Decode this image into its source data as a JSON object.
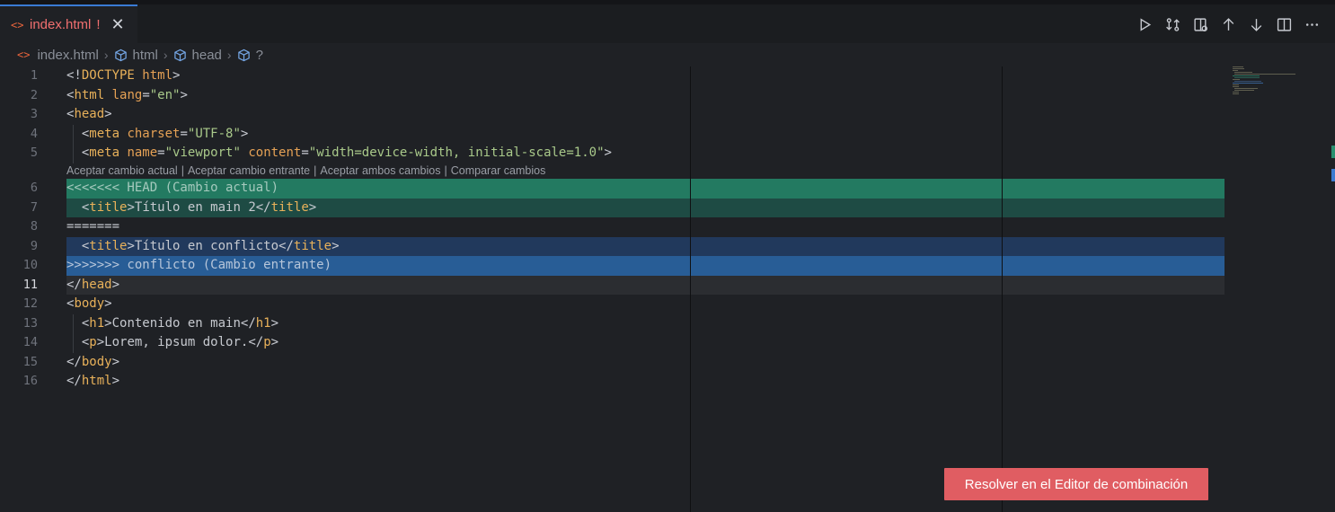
{
  "tab": {
    "file_icon": "<>",
    "label": "index.html",
    "modified_marker": "!",
    "close": "✕"
  },
  "toolbar": [
    {
      "name": "run-icon"
    },
    {
      "name": "compare-changes-icon"
    },
    {
      "name": "open-changes-icon"
    },
    {
      "name": "previous-conflict-icon"
    },
    {
      "name": "next-conflict-icon"
    },
    {
      "name": "split-editor-icon"
    },
    {
      "name": "more-actions-icon"
    }
  ],
  "breadcrumb": {
    "file_icon": "<>",
    "file": "index.html",
    "items": [
      "html",
      "head",
      "?"
    ]
  },
  "line_numbers": [
    "1",
    "2",
    "3",
    "4",
    "5",
    "6",
    "7",
    "8",
    "9",
    "10",
    "11",
    "12",
    "13",
    "14",
    "15",
    "16"
  ],
  "active_line": "11",
  "codelens": {
    "accept_current": "Aceptar cambio actual",
    "accept_incoming": "Aceptar cambio entrante",
    "accept_both": "Aceptar ambos cambios",
    "compare": "Comparar cambios",
    "separator": "|"
  },
  "code": {
    "l1": {
      "open": "<!",
      "tag": "DOCTYPE",
      "rest": " html",
      "close": ">"
    },
    "l2": {
      "open": "<",
      "tag": "html",
      "attr": " lang",
      "eq": "=",
      "val": "\"en\"",
      "close": ">"
    },
    "l3": {
      "open": "<",
      "tag": "head",
      "close": ">"
    },
    "l4": {
      "indent": "  ",
      "open": "<",
      "tag": "meta",
      "attr": " charset",
      "eq": "=",
      "val": "\"UTF-8\"",
      "close": ">"
    },
    "l5": {
      "indent": "  ",
      "open": "<",
      "tag": "meta",
      "attr1": " name",
      "eq1": "=",
      "val1": "\"viewport\"",
      "attr2": " content",
      "eq2": "=",
      "val2": "\"width=device-width, initial-scale=1.0\"",
      "close": ">"
    },
    "l6": {
      "text": "<<<<<<< HEAD (Cambio actual)"
    },
    "l7": {
      "indent": "  ",
      "open": "<",
      "tag": "title",
      "close": ">",
      "text": "Título en main 2",
      "endopen": "</",
      "endtag": "title",
      "endclose": ">"
    },
    "l8": {
      "text": "======="
    },
    "l9": {
      "indent": "  ",
      "open": "<",
      "tag": "title",
      "close": ">",
      "text": "Título en conflicto",
      "endopen": "</",
      "endtag": "title",
      "endclose": ">"
    },
    "l10": {
      "text": ">>>>>>> conflicto (Cambio entrante)"
    },
    "l11": {
      "open": "</",
      "tag": "head",
      "close": ">"
    },
    "l12": {
      "open": "<",
      "tag": "body",
      "close": ">"
    },
    "l13": {
      "indent": "  ",
      "open": "<",
      "tag": "h1",
      "close": ">",
      "text": "Contenido en main",
      "endopen": "</",
      "endtag": "h1",
      "endclose": ">"
    },
    "l14": {
      "indent": "  ",
      "open": "<",
      "tag": "p",
      "close": ">",
      "text": "Lorem, ipsum dolor.",
      "endopen": "</",
      "endtag": "p",
      "endclose": ">"
    },
    "l15": {
      "open": "</",
      "tag": "body",
      "close": ">"
    },
    "l16": {
      "open": "</",
      "tag": "html",
      "close": ">"
    }
  },
  "resolve_button": "Resolver en el Editor de combinación",
  "colors": {
    "current_marker": "#237a61",
    "current_block": "#1e4b44",
    "incoming_block": "#21395c",
    "incoming_marker": "#285d96",
    "resolve_button": "#e05d62",
    "tab_label": "#f06f6f"
  }
}
